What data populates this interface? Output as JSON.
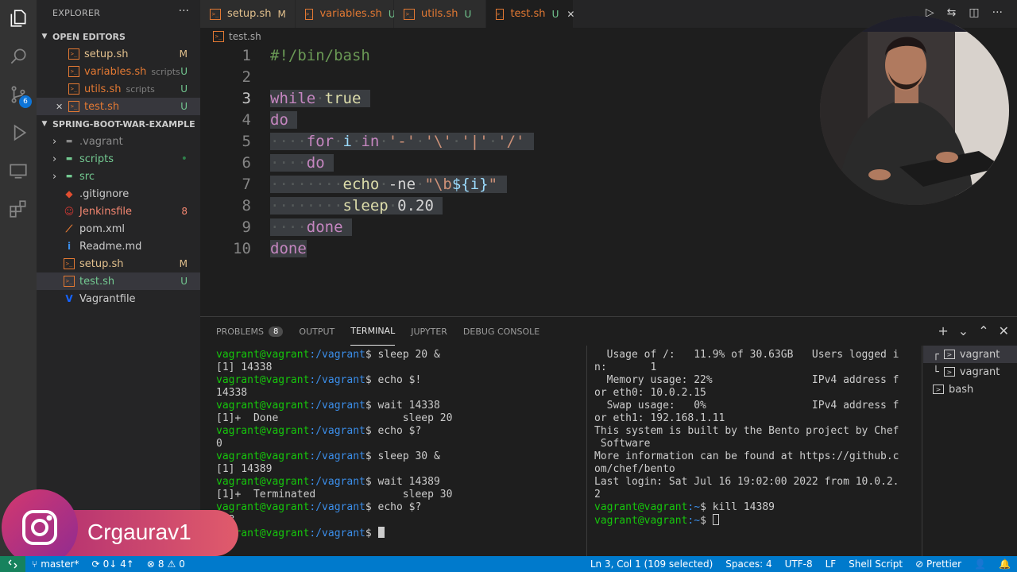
{
  "sidebar": {
    "title": "EXPLORER",
    "more": "···",
    "open_editors_label": "OPEN EDITORS",
    "open_editors": [
      {
        "name": "setup.sh",
        "path": "",
        "status": "M",
        "status_type": "m",
        "close": ""
      },
      {
        "name": "variables.sh",
        "path": "scripts",
        "status": "U",
        "status_type": "u",
        "close": ""
      },
      {
        "name": "utils.sh",
        "path": "scripts",
        "status": "U",
        "status_type": "u",
        "close": ""
      },
      {
        "name": "test.sh",
        "path": "",
        "status": "U",
        "status_type": "u",
        "close": "✕"
      }
    ],
    "project_label": "SPRING-BOOT-WAR-EXAMPLE",
    "files": [
      {
        "name": ".vagrant",
        "type": "folder",
        "status": ""
      },
      {
        "name": "scripts",
        "type": "folder",
        "status": "•"
      },
      {
        "name": "src",
        "type": "folder",
        "status": ""
      },
      {
        "name": ".gitignore",
        "type": "git",
        "status": ""
      },
      {
        "name": "Jenkinsfile",
        "type": "jenkins",
        "status": "8"
      },
      {
        "name": "pom.xml",
        "type": "xml",
        "status": ""
      },
      {
        "name": "Readme.md",
        "type": "info",
        "status": ""
      },
      {
        "name": "setup.sh",
        "type": "sh",
        "status": "M"
      },
      {
        "name": "test.sh",
        "type": "sh",
        "status": "U"
      },
      {
        "name": "Vagrantfile",
        "type": "vagrant",
        "status": ""
      }
    ]
  },
  "activity": {
    "scm_badge": "6"
  },
  "tabs": [
    {
      "name": "setup.sh",
      "status": "M"
    },
    {
      "name": "variables.sh",
      "status": "U"
    },
    {
      "name": "utils.sh",
      "status": "U"
    },
    {
      "name": "test.sh",
      "status": "U",
      "close": "✕"
    }
  ],
  "breadcrumb": "test.sh",
  "editor": {
    "line_numbers": [
      "1",
      "2",
      "3",
      "4",
      "5",
      "6",
      "7",
      "8",
      "9",
      "10"
    ],
    "lines": [
      "#!/bin/bash",
      "",
      "while true",
      "do",
      "    for i in '-' '\\' '|' '/'",
      "    do",
      "        echo -ne \"\\b${i}\"",
      "        sleep 0.20",
      "    done",
      "done"
    ]
  },
  "panel": {
    "tabs": [
      "PROBLEMS",
      "OUTPUT",
      "TERMINAL",
      "JUPYTER",
      "DEBUG CONSOLE"
    ],
    "problems_count": "8",
    "actions": [
      "+",
      "⌄",
      "⌃",
      "✕"
    ],
    "terminal_left": [
      {
        "prompt": true,
        "cmd": "sleep 20 &"
      },
      {
        "text": "[1] 14338"
      },
      {
        "prompt": true,
        "cmd": "echo $!"
      },
      {
        "text": "14338"
      },
      {
        "prompt": true,
        "cmd": "wait 14338"
      },
      {
        "text": "[1]+  Done                    sleep 20"
      },
      {
        "prompt": true,
        "cmd": "echo $?"
      },
      {
        "text": "0"
      },
      {
        "prompt": true,
        "cmd": "sleep 30 &"
      },
      {
        "text": "[1] 14389"
      },
      {
        "prompt": true,
        "cmd": "wait 14389"
      },
      {
        "text": "[1]+  Terminated              sleep 30"
      },
      {
        "prompt": true,
        "cmd": "echo $?"
      },
      {
        "text": "143"
      },
      {
        "prompt": true,
        "cmd": ""
      }
    ],
    "prompt_user": "vagrant@vagrant",
    "prompt_path": ":/vagrant",
    "prompt_sym": "$ ",
    "terminal_right": [
      "  Usage of /:   11.9% of 30.63GB   Users logged i",
      "n:       1",
      "  Memory usage: 22%                IPv4 address f",
      "or eth0: 10.0.2.15",
      "  Swap usage:   0%                 IPv4 address f",
      "or eth1: 192.168.1.11",
      "",
      "",
      "This system is built by the Bento project by Chef",
      " Software",
      "More information can be found at https://github.c",
      "om/chef/bento",
      "Last login: Sat Jul 16 19:02:00 2022 from 10.0.2.",
      "2"
    ],
    "right_prompt_user": "vagrant@vagrant",
    "right_prompt_path": ":~",
    "right_prompts": [
      "kill 14389",
      ""
    ],
    "terminal_list": [
      {
        "prefix": "┌",
        "name": "vagrant"
      },
      {
        "prefix": "└",
        "name": "vagrant"
      },
      {
        "prefix": "",
        "name": "bash"
      }
    ]
  },
  "status": {
    "branch": "master*",
    "sync": "0↓ 4↑",
    "errors": "8",
    "warnings": "0",
    "cursor": "Ln 3, Col 1 (109 selected)",
    "spaces": "Spaces: 4",
    "encoding": "UTF-8",
    "eol": "LF",
    "language": "Shell Script",
    "prettier": "Prettier"
  },
  "watermark": {
    "handle": "Crgaurav1"
  },
  "colors": {
    "accent": "#007acc",
    "prompt_user": "#16c60c",
    "prompt_path": "#3b8eea",
    "keyword": "#c586c0"
  }
}
